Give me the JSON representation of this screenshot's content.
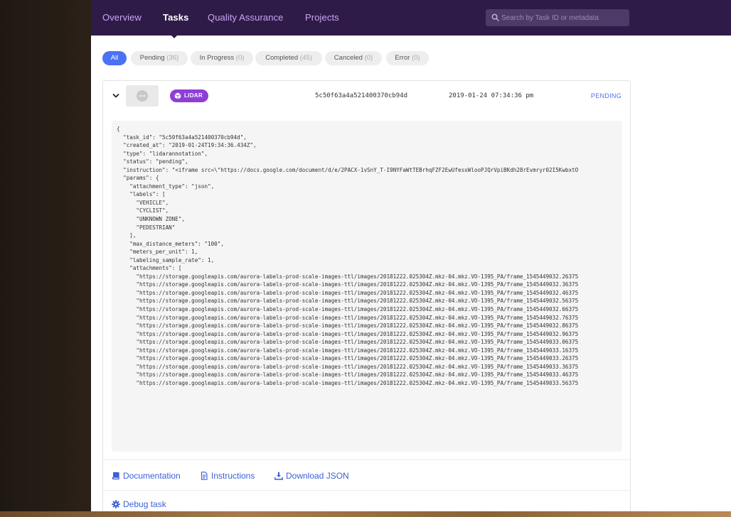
{
  "nav": {
    "items": [
      {
        "label": "Overview",
        "active": false
      },
      {
        "label": "Tasks",
        "active": true
      },
      {
        "label": "Quality Assurance",
        "active": false
      },
      {
        "label": "Projects",
        "active": false
      }
    ],
    "search": {
      "placeholder": "Search by Task ID or metadata",
      "value": ""
    }
  },
  "filters": [
    {
      "label": "All",
      "count": "",
      "active": true
    },
    {
      "label": "Pending",
      "count": "(36)",
      "active": false
    },
    {
      "label": "In Progress",
      "count": "(0)",
      "active": false
    },
    {
      "label": "Completed",
      "count": "(45)",
      "active": false
    },
    {
      "label": "Canceled",
      "count": "(0)",
      "active": false
    },
    {
      "label": "Error",
      "count": "(0)",
      "active": false
    }
  ],
  "task": {
    "badge": "LIDAR",
    "task_id": "5c50f63a4a521400370cb94d",
    "timestamp": "2019-01-24 07:34:36 pm",
    "status": "PENDING",
    "json_lines": [
      "{",
      "  \"task_id\": \"5c50f63a4a521400370cb94d\",",
      "  \"created_at\": \"2019-01-24T19:34:36.434Z\",",
      "  \"type\": \"lidarannotation\",",
      "  \"status\": \"pending\",",
      "  \"instruction\": \"<iframe src=\\\"https://docs.google.com/document/d/e/2PACX-1vSnY_T-I9NYFaWtTEBrhqFZF2EwUfesxWlooPJQrVpiBKdh28rEvmryr02I5KwbxtO",
      "  \"params\": {",
      "    \"attachment_type\": \"json\",",
      "    \"labels\": [",
      "      \"VEHICLE\",",
      "      \"CYCLIST\",",
      "      \"UNKNOWN ZONE\",",
      "      \"PEDESTRIAN\"",
      "    ],",
      "    \"max_distance_meters\": \"100\",",
      "    \"meters_per_unit\": 1,",
      "    \"labeling_sample_rate\": 1,",
      "    \"attachments\": [",
      "      \"https://storage.googleapis.com/aurora-labels-prod-scale-images-ttl/images/20181222.025304Z.mkz-04.mkz.VO-1395_PA/frame_1545449032.26375",
      "      \"https://storage.googleapis.com/aurora-labels-prod-scale-images-ttl/images/20181222.025304Z.mkz-04.mkz.VO-1395_PA/frame_1545449032.36375",
      "      \"https://storage.googleapis.com/aurora-labels-prod-scale-images-ttl/images/20181222.025304Z.mkz-04.mkz.VO-1395_PA/frame_1545449032.46375",
      "      \"https://storage.googleapis.com/aurora-labels-prod-scale-images-ttl/images/20181222.025304Z.mkz-04.mkz.VO-1395_PA/frame_1545449032.56375",
      "      \"https://storage.googleapis.com/aurora-labels-prod-scale-images-ttl/images/20181222.025304Z.mkz-04.mkz.VO-1395_PA/frame_1545449032.66375",
      "      \"https://storage.googleapis.com/aurora-labels-prod-scale-images-ttl/images/20181222.025304Z.mkz-04.mkz.VO-1395_PA/frame_1545449032.76375",
      "      \"https://storage.googleapis.com/aurora-labels-prod-scale-images-ttl/images/20181222.025304Z.mkz-04.mkz.VO-1395_PA/frame_1545449032.86375",
      "      \"https://storage.googleapis.com/aurora-labels-prod-scale-images-ttl/images/20181222.025304Z.mkz-04.mkz.VO-1395_PA/frame_1545449032.96375",
      "      \"https://storage.googleapis.com/aurora-labels-prod-scale-images-ttl/images/20181222.025304Z.mkz-04.mkz.VO-1395_PA/frame_1545449033.06375",
      "      \"https://storage.googleapis.com/aurora-labels-prod-scale-images-ttl/images/20181222.025304Z.mkz-04.mkz.VO-1395_PA/frame_1545449033.16375",
      "      \"https://storage.googleapis.com/aurora-labels-prod-scale-images-ttl/images/20181222.025304Z.mkz-04.mkz.VO-1395_PA/frame_1545449033.26375",
      "      \"https://storage.googleapis.com/aurora-labels-prod-scale-images-ttl/images/20181222.025304Z.mkz-04.mkz.VO-1395_PA/frame_1545449033.36375",
      "      \"https://storage.googleapis.com/aurora-labels-prod-scale-images-ttl/images/20181222.025304Z.mkz-04.mkz.VO-1395_PA/frame_1545449033.46375",
      "      \"https://storage.googleapis.com/aurora-labels-prod-scale-images-ttl/images/20181222.025304Z.mkz-04.mkz.VO-1395_PA/frame_1545449033.56375"
    ]
  },
  "actions": {
    "documentation": "Documentation",
    "instructions": "Instructions",
    "download_json": "Download JSON",
    "debug": "Debug task"
  },
  "colors": {
    "nav_bg": "#2f1b48",
    "nav_link": "#c9a7f3",
    "accent": "#4a72f5",
    "badge": "#8e3ed8",
    "link": "#3b5fd9"
  }
}
